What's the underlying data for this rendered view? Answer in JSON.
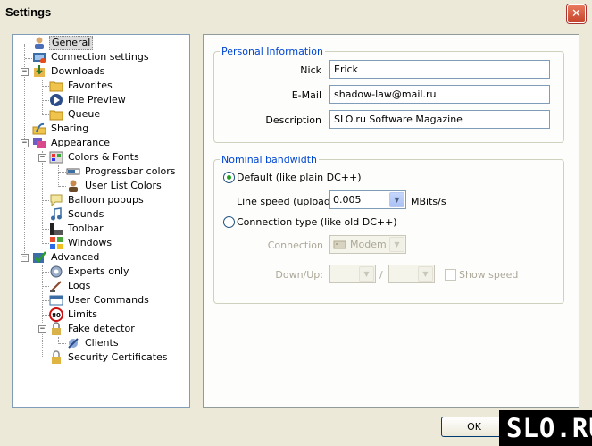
{
  "window": {
    "title": "Settings",
    "close_glyph": "✕"
  },
  "tree": {
    "expander_minus": "−",
    "items": [
      {
        "label": "General",
        "icon": "user-icon",
        "selected": true
      },
      {
        "label": "Connection settings",
        "icon": "network-icon"
      },
      {
        "label": "Downloads",
        "icon": "downloads-icon"
      },
      {
        "label": "Favorites",
        "icon": "folder-icon"
      },
      {
        "label": "File Preview",
        "icon": "play-icon"
      },
      {
        "label": "Queue",
        "icon": "folder-icon"
      },
      {
        "label": "Sharing",
        "icon": "sharing-icon"
      },
      {
        "label": "Appearance",
        "icon": "appearance-icon"
      },
      {
        "label": "Colors & Fonts",
        "icon": "palette-icon"
      },
      {
        "label": "Progressbar colors",
        "icon": "progressbar-icon"
      },
      {
        "label": "User List Colors",
        "icon": "user-icon"
      },
      {
        "label": "Balloon popups",
        "icon": "balloon-icon"
      },
      {
        "label": "Sounds",
        "icon": "music-note-icon"
      },
      {
        "label": "Toolbar",
        "icon": "toolbar-icon"
      },
      {
        "label": "Windows",
        "icon": "windows-icon"
      },
      {
        "label": "Advanced",
        "icon": "advanced-icon"
      },
      {
        "label": "Experts only",
        "icon": "gear-icon"
      },
      {
        "label": "Logs",
        "icon": "logs-icon"
      },
      {
        "label": "User Commands",
        "icon": "commands-icon"
      },
      {
        "label": "Limits",
        "icon": "speed-limit-icon"
      },
      {
        "label": "Fake detector",
        "icon": "fake-detector-icon"
      },
      {
        "label": "Clients",
        "icon": "clients-icon"
      },
      {
        "label": "Security Certificates",
        "icon": "lock-icon"
      }
    ]
  },
  "personal": {
    "legend": "Personal Information",
    "nick_label": "Nick",
    "nick_value": "Erick",
    "email_label": "E-Mail",
    "email_value": "shadow-law@mail.ru",
    "description_label": "Description",
    "description_value": "SLO.ru Software Magazine"
  },
  "bandwidth": {
    "legend": "Nominal bandwidth",
    "default_label": "Default (like plain DC++)",
    "line_speed_label": "Line speed (upload)",
    "line_speed_value": "0.005",
    "unit": "MBits/s",
    "conn_type_label": "Connection type (like old DC++)",
    "connection_label": "Connection",
    "connection_value": "Modem",
    "downup_label": "Down/Up:",
    "separator": "/",
    "show_speed_label": "Show speed",
    "selected": "default"
  },
  "buttons": {
    "ok": "OK"
  },
  "watermark": {
    "text": "SLO.RU"
  },
  "colors": {
    "legend_blue": "#0046d5",
    "selection": "#dcdcdc"
  }
}
